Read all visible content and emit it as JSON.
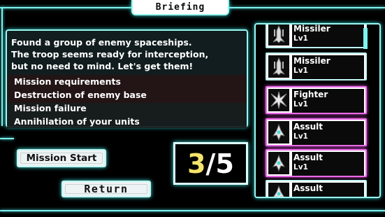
{
  "header": {
    "title": "Briefing"
  },
  "briefing": {
    "description": [
      "Found a group of enemy spaceships.",
      "The troop seems ready for interception,",
      "but no need to mind. Let's get them!"
    ],
    "requirements": [
      "Mission requirements",
      "Destruction of enemy base",
      "Mission failure",
      "Annihilation of your units"
    ]
  },
  "buttons": {
    "mission_start": "Mission Start",
    "return": "Return"
  },
  "counter": {
    "current": "3",
    "separator": "/",
    "max": "5"
  },
  "units": [
    {
      "name": "Missiler",
      "level": "Lv1",
      "icon": "missiler-ship-icon"
    },
    {
      "name": "Missiler",
      "level": "Lv1",
      "icon": "missiler-ship-icon"
    },
    {
      "name": "Fighter",
      "level": "Lv1",
      "icon": "fighter-ship-icon"
    },
    {
      "name": "Assult",
      "level": "Lv1",
      "icon": "assult-ship-icon"
    },
    {
      "name": "Assult",
      "level": "Lv1",
      "icon": "assult-ship-icon"
    },
    {
      "name": "Assult",
      "level": "",
      "icon": "assult-ship-icon"
    }
  ],
  "colors": {
    "frame": "#7ef2ee",
    "selected": "#e96be6",
    "counter_current": "#f4e46a"
  }
}
